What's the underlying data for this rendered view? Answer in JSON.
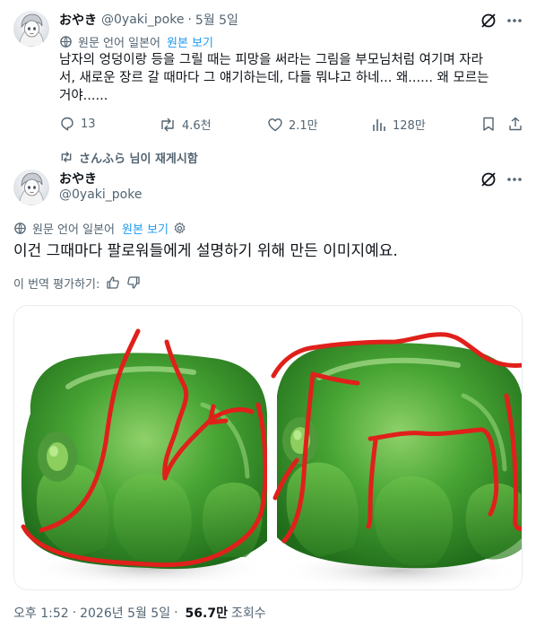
{
  "tweet1": {
    "display_name": "おやき",
    "handle": "@0yaki_poke",
    "separator": "·",
    "date": "5월 5일",
    "translation": {
      "label": "원문 언어 일본어",
      "show_original": "원본 보기"
    },
    "body_lines": [
      "남자의 엉덩이랑 등을 그릴 때는 피망을 써라는 그림을 부모님처럼 여기며 자라",
      "서, 새로운 장르 갈 때마다 그 얘기하는데, 다들 뭐냐고 하네... 왜...... 왜 모르는",
      "거야......"
    ],
    "actions": {
      "replies": "13",
      "reposts": "4.6천",
      "likes": "2.1만",
      "views": "128만"
    },
    "icons": [
      "grok-icon",
      "more-icon",
      "reply-icon",
      "repost-icon",
      "like-icon",
      "views-icon",
      "bookmark-icon",
      "share-icon"
    ]
  },
  "repost_notice": "さんふら 님이 재게시함",
  "tweet2": {
    "display_name": "おやき",
    "handle": "@0yaki_poke",
    "translation": {
      "label": "원문 언어 일본어",
      "show_original": "원본 보기"
    },
    "body": "이건 그때마다 팔로워들에게 설명하기 위해 만든 이미지예요.",
    "rate_prompt": "이 번역 평가하기:",
    "meta": {
      "time": "오후 1:52",
      "separator": "·",
      "date": "2026년 5월 5일",
      "views": "56.7만",
      "views_label": "조회수"
    }
  },
  "colors": {
    "text": "#0f1419",
    "secondary": "#536471",
    "link": "#1d9bf0",
    "pepper_green": "#3d9a2f",
    "annotation_red": "#e0201b"
  }
}
